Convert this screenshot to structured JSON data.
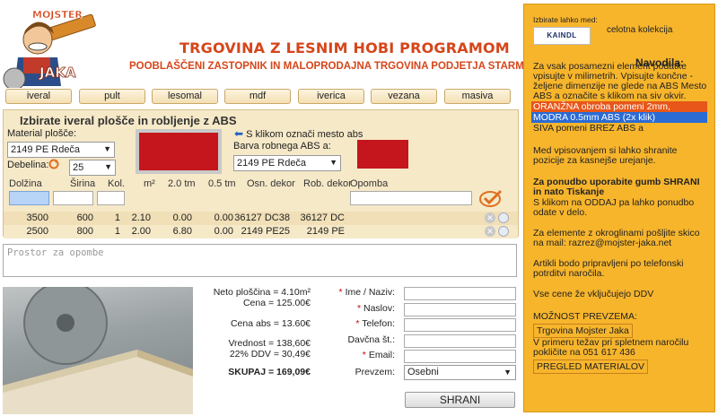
{
  "header": {
    "logo_text_top": "MOJSTER",
    "logo_text_bottom": "JAKA",
    "title": "TRGOVINA Z LESNIM HOBI PROGRAMOM",
    "subtitle": "POOBLAŠČENI ZASTOPNIK IN MALOPRODAJNA TRGOVINA PODJETJA STARMAN"
  },
  "nav": [
    "iveral",
    "pult",
    "lesomal",
    "mdf",
    "iverica",
    "vezana",
    "masiva"
  ],
  "panel": {
    "title": "Izbirate iveral plošče in robljenje z ABS",
    "material_label": "Material plošče:",
    "material_value": "2149 PE Rdeča",
    "debelina_label": "Debelina:",
    "debelina_value": "25",
    "hint": "S klikom označi mesto abs",
    "abs_label": "Barva robnega ABS a:",
    "abs_value": "2149 PE Rdeča",
    "columns": [
      "Dolžina",
      "Širina",
      "Kol.",
      "m²",
      "2.0 tm",
      "0.5 tm",
      "Osn. dekor",
      "Rob. dekor",
      "Opomba"
    ],
    "rows": [
      {
        "dolzina": "3500",
        "sirina": "600",
        "kol": "1",
        "m2": "2.10",
        "t20": "0.00",
        "t05": "0.00",
        "osn": "36127 DC38",
        "rob": "36127 DC"
      },
      {
        "dolzina": "2500",
        "sirina": "800",
        "kol": "1",
        "m2": "2.00",
        "t20": "6.80",
        "t05": "0.00",
        "osn": "2149 PE25",
        "rob": "2149 PE"
      }
    ]
  },
  "notes_placeholder": "Prostor za opombe",
  "totals": {
    "neto": "Neto ploščina = 4.10m²",
    "cena": "Cena = 125.00€",
    "cena_abs": "Cena abs = 13.60€",
    "vrednost": "Vrednost = 138,60€",
    "ddv": "22% DDV = 30,49€",
    "skupaj": "SKUPAJ = 169,09€"
  },
  "form": {
    "ime_label": "Ime / Naziv:",
    "naslov_label": "Naslov:",
    "telefon_label": "Telefon:",
    "davcna_label": "Davčna št.:",
    "email_label": "Email:",
    "prevzem_label": "Prevzem:",
    "prevzem_value": "Osebni",
    "star": "*",
    "submit": "SHRANI"
  },
  "sidebar": {
    "izbirate": "Izbirate lahko med:",
    "kaindl": "KAINDL",
    "kolekcija": "celotna kolekcija",
    "nav_title": "Navodila:",
    "p1": "Za vsak posamezni element podatke vpisujte v milimetrih. Vpisujte končne - željene dimenzije ne glede na ABS Mesto ABS a označite s klikom na siv okvir.",
    "orange": "ORANŽNA obroba pomeni 2mm,",
    "blue": "MODRA 0.5mm ABS (2x klik)",
    "siva": "SIVA pomeni BREZ ABS a",
    "p2": "Med vpisovanjem si lahko shranite pozicije za kasnejše urejanje.",
    "p3_bold": "Za ponudbo uporabite gumb SHRANI in nato Tiskanje",
    "p3": "S klikom na ODDAJ pa lahko ponudbo odate v delo.",
    "p4": "Za elemente z okroglinami pošljite skico na mail: razrez@mojster-jaka.net",
    "p5": "Artikli bodo pripravljeni po telefonski potrditvi naročila.",
    "p6": "Vse cene že vključujejo DDV",
    "mozn": "MOŽNOST PREVZEMA:",
    "trgovina": "Trgovina Mojster Jaka",
    "p7": "V primeru težav pri spletnem naročilu pokličite na 051 617 436",
    "pregled": "PREGLED MATERIALOV"
  },
  "colors": {
    "accent": "#d5461a",
    "sidebar_bg": "#f7b52c",
    "panel_bg": "#f6e9c8",
    "swatch": "#c4161c",
    "orange_band": "#e8561a",
    "blue_band": "#2a6bd4"
  }
}
